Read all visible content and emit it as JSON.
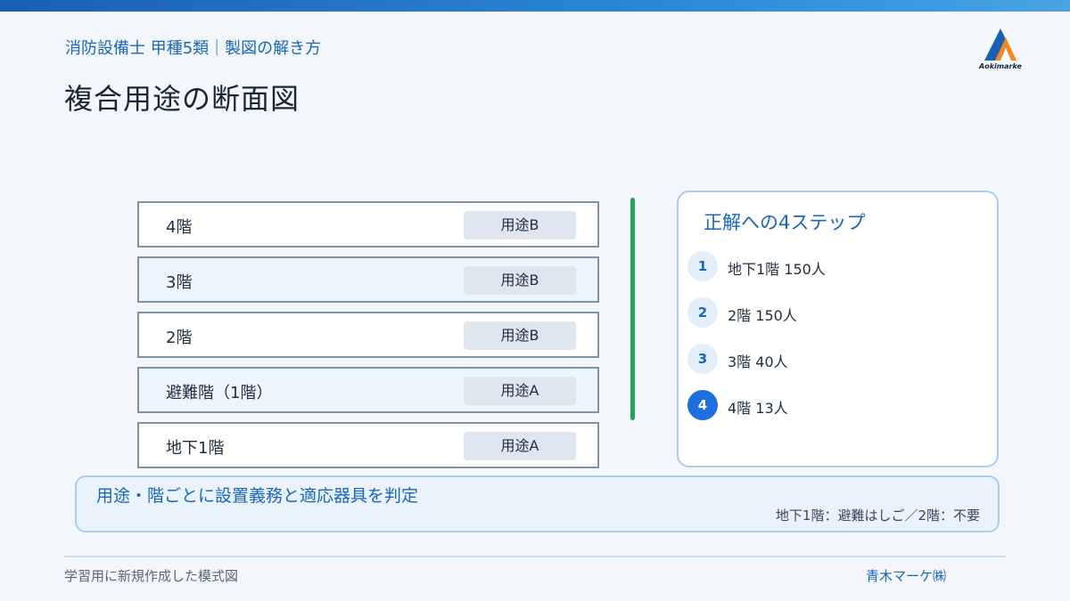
{
  "header": {
    "subtitle": "消防設備士 甲種5類｜製図の解き方",
    "title": "複合用途の断面図",
    "logo_text": "Aokimarke"
  },
  "floors": [
    {
      "label": "4階",
      "use": "用途B"
    },
    {
      "label": "3階",
      "use": "用途B"
    },
    {
      "label": "2階",
      "use": "用途B"
    },
    {
      "label": "避難階（1階）",
      "use": "用途A"
    },
    {
      "label": "地下1階",
      "use": "用途A"
    }
  ],
  "steps": {
    "title": "正解への4ステップ",
    "items": [
      {
        "num": "1",
        "text": "地下1階 150人"
      },
      {
        "num": "2",
        "text": "2階 150人"
      },
      {
        "num": "3",
        "text": "3階 40人"
      },
      {
        "num": "4",
        "text": "4階 13人"
      }
    ]
  },
  "info": {
    "main": "用途・階ごとに設置義務と適応器具を判定",
    "sub": "地下1階：避難はしご／2階：不要"
  },
  "footer": {
    "note": "学習用に新規作成した模式図",
    "company": "青木マーケ㈱"
  },
  "colors": {
    "accent": "#1a66b8",
    "active_step": "#1c6fdc",
    "divider_green": "#22a55b"
  }
}
